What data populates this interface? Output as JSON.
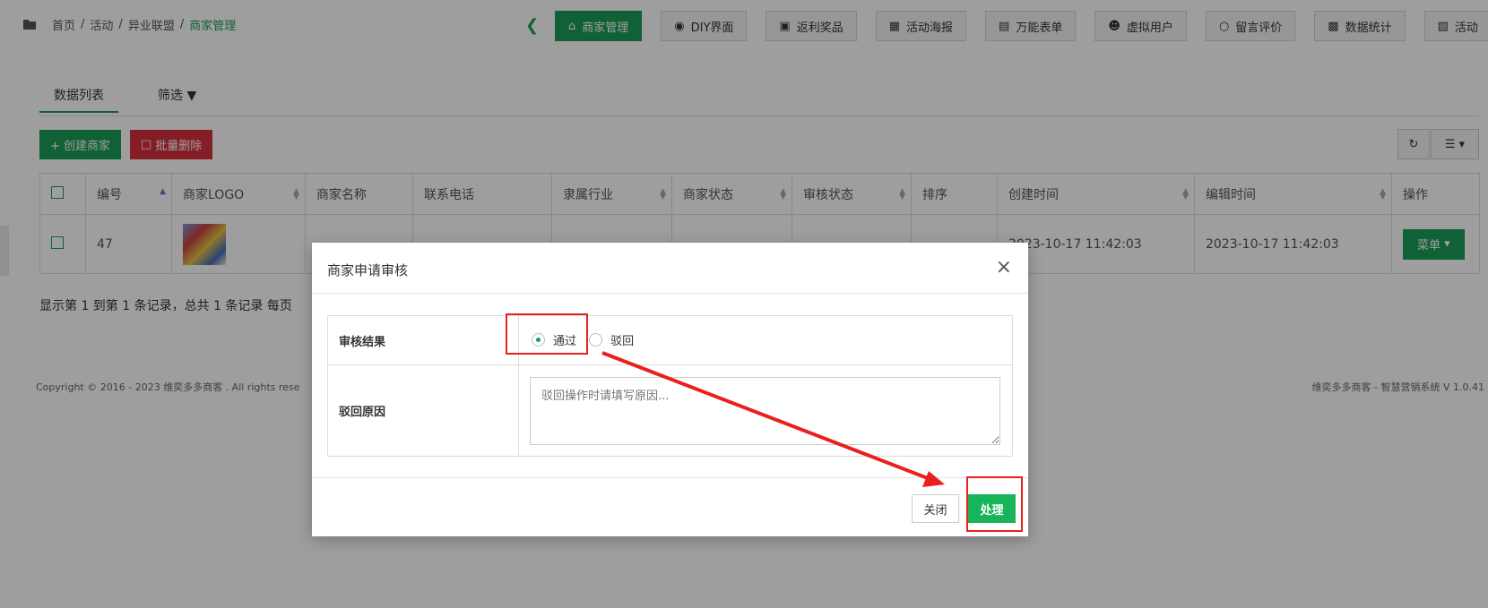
{
  "breadcrumb": {
    "home": "首页",
    "sep": "/",
    "activity": "活动",
    "alliance": "异业联盟",
    "current": "商家管理"
  },
  "nav_tabs": [
    {
      "label": "商家管理",
      "icon": "home-icon"
    },
    {
      "label": "DIY界面",
      "icon": "leaf-icon"
    },
    {
      "label": "返利奖品",
      "icon": "gift-icon"
    },
    {
      "label": "活动海报",
      "icon": "image-icon"
    },
    {
      "label": "万能表单",
      "icon": "file-icon"
    },
    {
      "label": "虚拟用户",
      "icon": "user-plus-icon"
    },
    {
      "label": "留言评价",
      "icon": "comment-icon"
    },
    {
      "label": "数据统计",
      "icon": "bar-chart-icon"
    },
    {
      "label": "活动",
      "icon": "copy-icon"
    }
  ],
  "sub_tabs": {
    "list": "数据列表",
    "filter": "筛选"
  },
  "toolbar": {
    "create": "+ 创建商家",
    "batch_delete": "批量删除"
  },
  "table": {
    "headers": [
      "编号",
      "商家LOGO",
      "商家名称",
      "联系电话",
      "隶属行业",
      "商家状态",
      "审核状态",
      "排序",
      "创建时间",
      "编辑时间",
      "操作"
    ],
    "row": {
      "id": "47",
      "created": "2023-10-17 11:42:03",
      "edited": "2023-10-17 11:42:03",
      "action": "菜单"
    }
  },
  "summary": "显示第 1 到第 1 条记录，总共 1 条记录   每页",
  "footer": {
    "copyright": "Copyright © 2016 - 2023 维奕多多商客 . All rights rese",
    "version": "维奕多多商客 - 智慧营销系统 V 1.0.41"
  },
  "modal": {
    "title": "商家申请审核",
    "result_label": "审核结果",
    "option_pass": "通过",
    "option_reject": "驳回",
    "reason_label": "驳回原因",
    "reason_placeholder": "驳回操作时请填写原因...",
    "close_button": "关闭",
    "process_button": "处理"
  },
  "annotation_color": "#e8201e",
  "accent_color": "#1b9d56"
}
